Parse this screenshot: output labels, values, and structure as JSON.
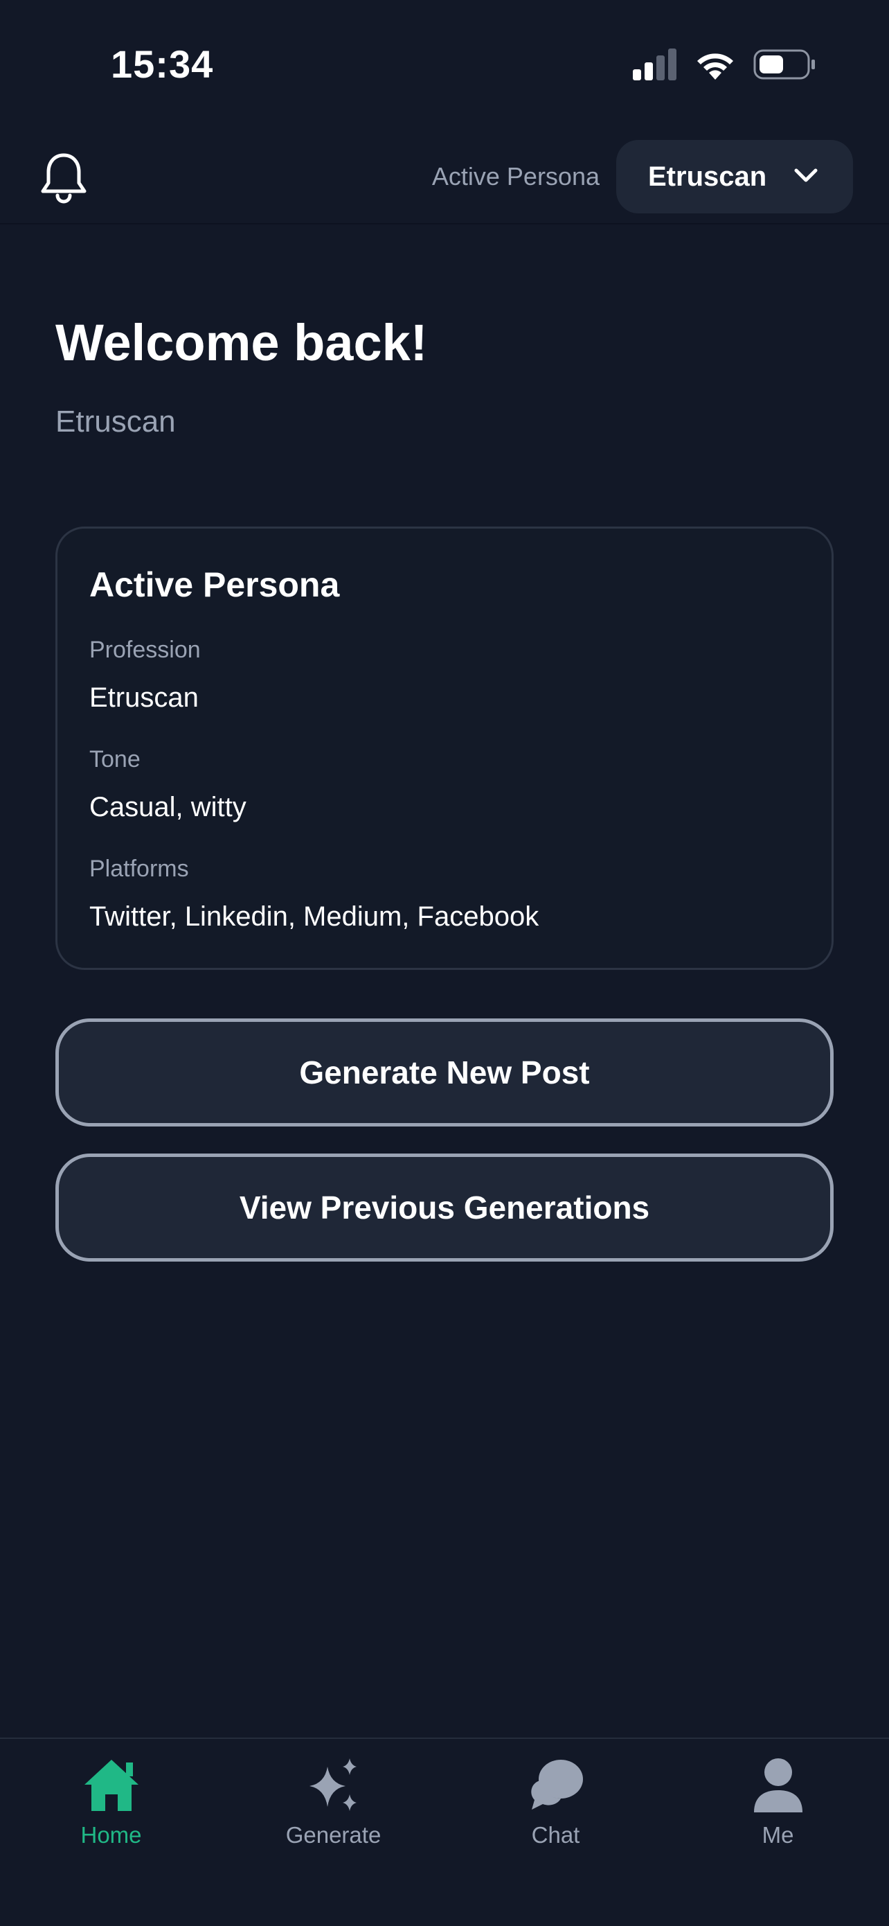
{
  "status_bar": {
    "time": "15:34"
  },
  "header": {
    "active_persona_label": "Active Persona",
    "selected_persona": "Etruscan",
    "icons": [
      "bell-icon",
      "chevron-down-icon"
    ]
  },
  "welcome": {
    "title": "Welcome back!",
    "subtitle": "Etruscan"
  },
  "persona_card": {
    "title": "Active Persona",
    "fields": [
      {
        "label": "Profession",
        "value": "Etruscan"
      },
      {
        "label": "Tone",
        "value": "Casual, witty"
      },
      {
        "label": "Platforms",
        "value": "Twitter, Linkedin, Medium, Facebook"
      }
    ]
  },
  "actions": {
    "generate_label": "Generate New Post",
    "history_label": "View Previous Generations"
  },
  "tabbar": {
    "tabs": [
      {
        "label": "Home",
        "icon": "home-icon",
        "active": true
      },
      {
        "label": "Generate",
        "icon": "sparkles-icon",
        "active": false
      },
      {
        "label": "Chat",
        "icon": "chat-bubbles-icon",
        "active": false
      },
      {
        "label": "Me",
        "icon": "user-icon",
        "active": false
      }
    ]
  },
  "colors": {
    "background": "#121827",
    "surface": "#1f2737",
    "accent": "#20b886",
    "muted_text": "#9aa3b4"
  }
}
